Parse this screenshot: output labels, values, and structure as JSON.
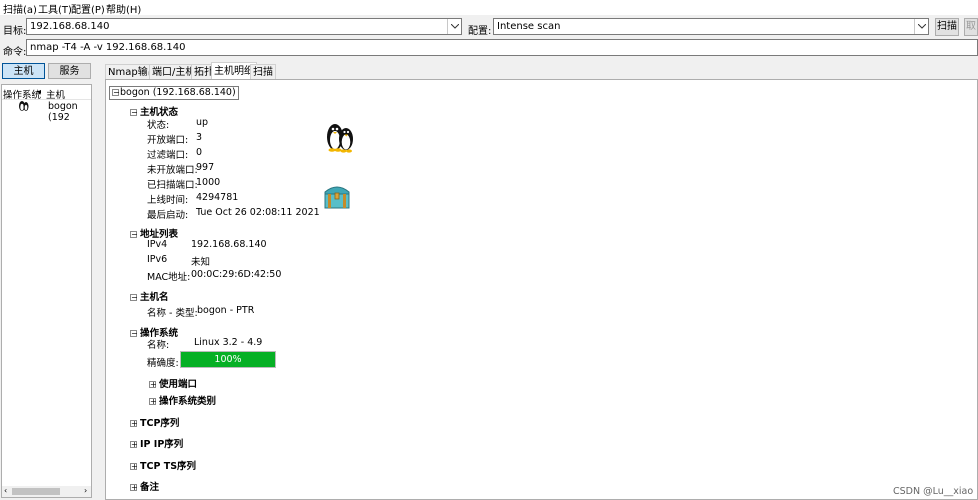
{
  "menu": [
    "扫描(a)",
    "工具(T)",
    "配置(P)",
    "帮助(H)"
  ],
  "target": {
    "label": "目标:",
    "value": "192.168.68.140"
  },
  "profile": {
    "label": "配置:",
    "value": "Intense scan"
  },
  "buttons": {
    "scan": "扫描",
    "cancel": "取消"
  },
  "command": {
    "label": "命令:",
    "value": "nmap -T4 -A -v 192.168.68.140"
  },
  "left": {
    "tab_hosts": "主机",
    "tab_services": "服务",
    "col_os": "操作系统",
    "col_host": "主机",
    "hosts": [
      "bogon (192"
    ]
  },
  "tabs": [
    "Nmap输出",
    "端口/主机",
    "拓扑",
    "主机明细",
    "扫描"
  ],
  "detail": {
    "host_title": "bogon (192.168.68.140)",
    "status_section": "主机状态",
    "status_rows": [
      {
        "label": "状态:",
        "value": "up"
      },
      {
        "label": "开放端口:",
        "value": "3"
      },
      {
        "label": "过滤端口:",
        "value": "0"
      },
      {
        "label": "未开放端口:",
        "value": "997"
      },
      {
        "label": "已扫描端口:",
        "value": "1000"
      },
      {
        "label": "上线时间:",
        "value": "4294781"
      },
      {
        "label": "最后启动:",
        "value": "Tue Oct 26 02:08:11 2021"
      }
    ],
    "address_section": "地址列表",
    "address_rows": [
      {
        "label": "IPv4",
        "value": "192.168.68.140"
      },
      {
        "label": "IPv6",
        "value": "未知"
      },
      {
        "label": "MAC地址:",
        "value": "00:0C:29:6D:42:50"
      }
    ],
    "hostname_section": "主机名",
    "hostname_row": {
      "label": "名称 - 类型:",
      "value": "bogon - PTR"
    },
    "os_section": "操作系统",
    "os_name": {
      "label": "名称:",
      "value": "Linux 3.2 - 4.9"
    },
    "os_accuracy": {
      "label": "精确度:",
      "value": "100%",
      "fraction": 1.0
    },
    "os_sub": [
      "使用端口",
      "操作系统类别"
    ],
    "tcp_seq": "TCP序列",
    "ip_seq": "IP IP序列",
    "tcp_ts_seq": "TCP TS序列",
    "notes": "备注"
  },
  "watermark": "CSDN @Lu__xiao",
  "colors": {
    "progress": "#06b025",
    "selected_tab": "#cce4f7"
  }
}
